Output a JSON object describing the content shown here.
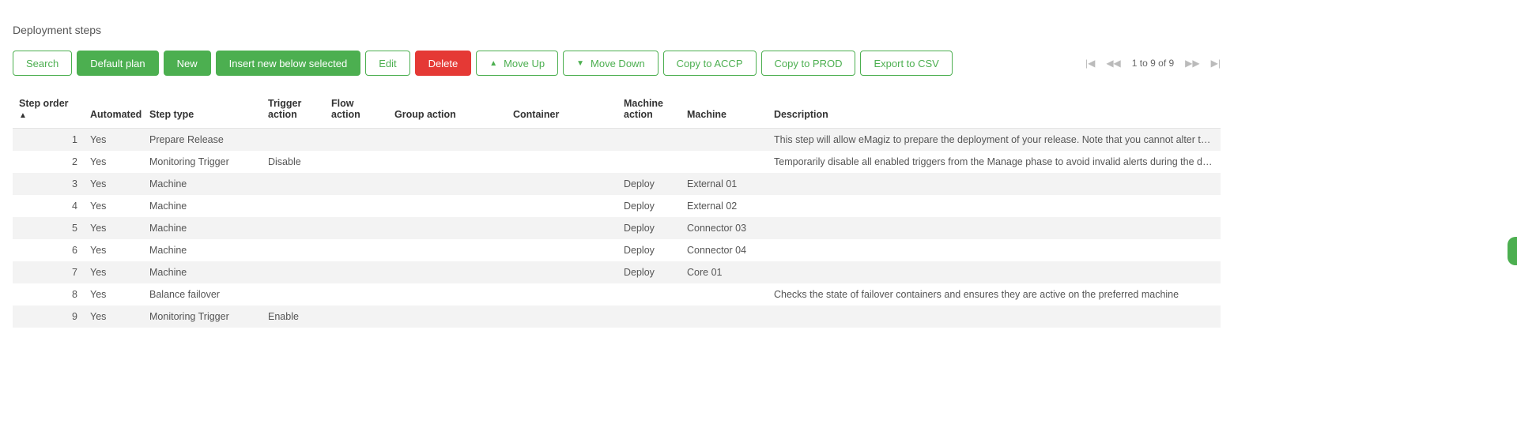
{
  "title": "Deployment steps",
  "toolbar": {
    "search": "Search",
    "default_plan": "Default plan",
    "new": "New",
    "insert_below": "Insert new below selected",
    "edit": "Edit",
    "delete": "Delete",
    "move_up": "Move Up",
    "move_down": "Move Down",
    "copy_accp": "Copy to ACCP",
    "copy_prod": "Copy to PROD",
    "export_csv": "Export to CSV"
  },
  "pager": {
    "text": "1 to 9 of 9"
  },
  "columns": {
    "step_order": "Step order",
    "automated": "Automated",
    "step_type": "Step type",
    "trigger_action": "Trigger action",
    "flow_action": "Flow action",
    "group_action": "Group action",
    "container": "Container",
    "machine_action": "Machine action",
    "machine": "Machine",
    "description": "Description"
  },
  "rows": [
    {
      "step_order": "1",
      "automated": "Yes",
      "step_type": "Prepare Release",
      "trigger_action": "",
      "flow_action": "",
      "group_action": "",
      "container": "",
      "machine_action": "",
      "machine": "",
      "description": "This step will allow eMagiz to prepare the deployment of your release. Note that you cannot alter this step, as doing …"
    },
    {
      "step_order": "2",
      "automated": "Yes",
      "step_type": "Monitoring Trigger",
      "trigger_action": "Disable",
      "flow_action": "",
      "group_action": "",
      "container": "",
      "machine_action": "",
      "machine": "",
      "description": "Temporarily disable all enabled triggers from the Manage phase to avoid invalid alerts during the deployment. Those…"
    },
    {
      "step_order": "3",
      "automated": "Yes",
      "step_type": "Machine",
      "trigger_action": "",
      "flow_action": "",
      "group_action": "",
      "container": "",
      "machine_action": "Deploy",
      "machine": "External 01",
      "description": ""
    },
    {
      "step_order": "4",
      "automated": "Yes",
      "step_type": "Machine",
      "trigger_action": "",
      "flow_action": "",
      "group_action": "",
      "container": "",
      "machine_action": "Deploy",
      "machine": "External 02",
      "description": ""
    },
    {
      "step_order": "5",
      "automated": "Yes",
      "step_type": "Machine",
      "trigger_action": "",
      "flow_action": "",
      "group_action": "",
      "container": "",
      "machine_action": "Deploy",
      "machine": "Connector 03",
      "description": ""
    },
    {
      "step_order": "6",
      "automated": "Yes",
      "step_type": "Machine",
      "trigger_action": "",
      "flow_action": "",
      "container": "",
      "group_action": "",
      "machine_action": "Deploy",
      "machine": "Connector 04",
      "description": ""
    },
    {
      "step_order": "7",
      "automated": "Yes",
      "step_type": "Machine",
      "trigger_action": "",
      "flow_action": "",
      "group_action": "",
      "container": "",
      "machine_action": "Deploy",
      "machine": "Core 01",
      "description": ""
    },
    {
      "step_order": "8",
      "automated": "Yes",
      "step_type": "Balance failover",
      "trigger_action": "",
      "flow_action": "",
      "group_action": "",
      "container": "",
      "machine_action": "",
      "machine": "",
      "description": "Checks the state of failover containers and ensures they are active on the preferred machine"
    },
    {
      "step_order": "9",
      "automated": "Yes",
      "step_type": "Monitoring Trigger",
      "trigger_action": "Enable",
      "flow_action": "",
      "group_action": "",
      "container": "",
      "machine_action": "",
      "machine": "",
      "description": ""
    }
  ]
}
